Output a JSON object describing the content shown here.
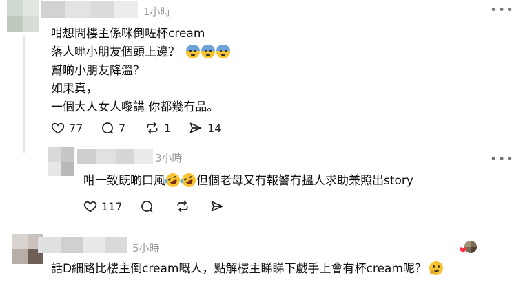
{
  "post1": {
    "time": "1小時",
    "lines": [
      "咁想問樓主係咪倒咗杯cream",
      "落人哋小朋友個頭上邊？",
      "幫啲小朋友降溫？",
      "如果真，",
      "一個大人女人嚟講 你都幾冇品。"
    ],
    "emoji_line1": [
      "fearful-face-emoji",
      "fearful-face-emoji",
      "fearful-face-emoji"
    ],
    "likes": "77",
    "replies": "7",
    "reposts": "1",
    "shares": "14"
  },
  "reply1": {
    "time": "3小時",
    "text_a": "咁一致既啲口風",
    "text_b": "但個老母又冇報警冇搵人求助兼照出story",
    "emojis": [
      "rolling-laughing-emoji",
      "rolling-laughing-emoji"
    ],
    "likes": "117"
  },
  "post2": {
    "time": "5小時",
    "text": "話D細路比樓主倒cream嘅人，點解樓主睇睇下戲手上會有杯cream呢？",
    "emoji": "thinking-face-emoji"
  },
  "colors": {
    "text": "#111111",
    "meta": "#999999",
    "heart": "#ff3040",
    "emoji_yellow": "#f7c331"
  }
}
